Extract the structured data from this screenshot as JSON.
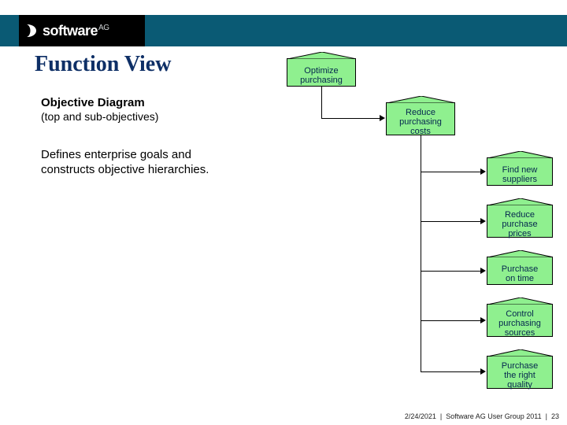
{
  "brand": {
    "logo_text": "software",
    "logo_suffix": "AG"
  },
  "page": {
    "title": "Function View",
    "subtitle": "Objective Diagram",
    "subtitle_sub": "(top and sub-objectives)",
    "description": "Defines enterprise goals and constructs objective hierarchies."
  },
  "diagram": {
    "root": {
      "label": "Optimize\npurchasing"
    },
    "child": {
      "label": "Reduce\npurchasing\ncosts"
    },
    "leaves": [
      {
        "label": "Find new\nsuppliers"
      },
      {
        "label": "Reduce\npurchase\nprices"
      },
      {
        "label": "Purchase\non time"
      },
      {
        "label": "Control\npurchasing\nsources"
      },
      {
        "label": "Purchase\nthe right\nquality"
      }
    ]
  },
  "footer": {
    "date": "2/24/2021",
    "event": "Software AG User Group 2011",
    "page_num": "23"
  }
}
